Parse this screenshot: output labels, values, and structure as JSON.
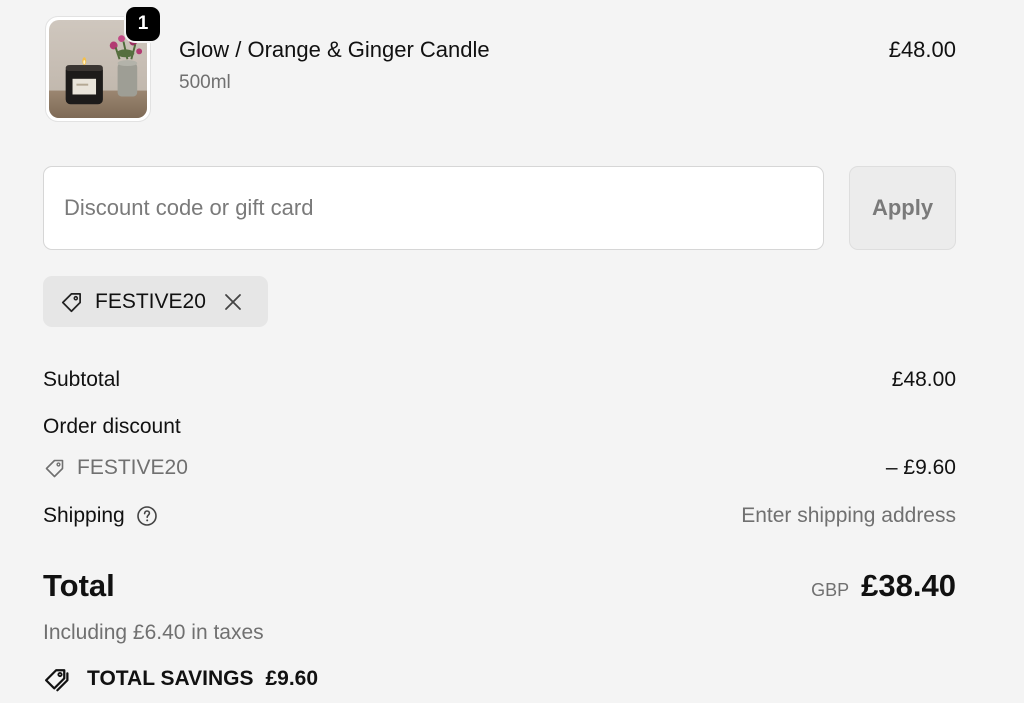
{
  "product": {
    "quantity": "1",
    "name": "Glow / Orange & Ginger Candle",
    "variant": "500ml",
    "price": "£48.00",
    "image_icon": "candle-product-photo"
  },
  "discount": {
    "placeholder": "Discount code or gift card",
    "value": "",
    "apply_label": "Apply",
    "applied_code": "FESTIVE20",
    "tag_icon": "tag-icon",
    "remove_icon": "close-icon"
  },
  "summary": {
    "subtotal_label": "Subtotal",
    "subtotal_value": "£48.00",
    "order_discount_label": "Order discount",
    "discount_code": "FESTIVE20",
    "discount_value": "– £9.60",
    "shipping_label": "Shipping",
    "shipping_help_icon": "question-circle-icon",
    "shipping_value": "Enter shipping address",
    "total_label": "Total",
    "total_currency": "GBP",
    "total_value": "£38.40",
    "taxes_note": "Including £6.40 in taxes",
    "savings_icon": "savings-tag-icon",
    "savings_label": "TOTAL SAVINGS",
    "savings_value": "£9.60"
  },
  "colors": {
    "background": "#f4f4f4",
    "text": "#111111",
    "muted": "#707070",
    "chip_bg": "#e6e6e6",
    "badge_bg": "#000000"
  }
}
